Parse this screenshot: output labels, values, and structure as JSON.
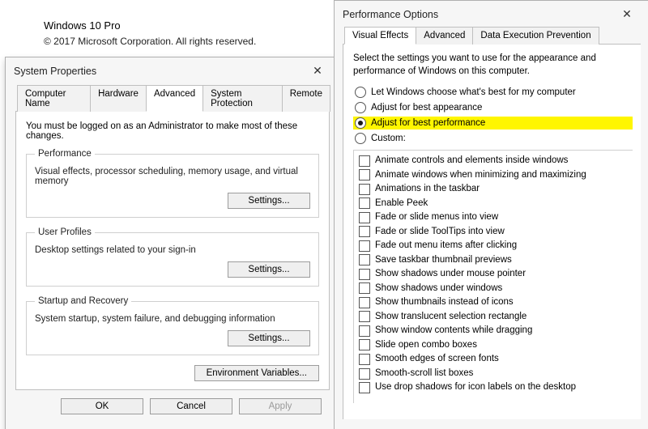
{
  "os": {
    "name": "Windows 10 Pro",
    "copyright": "© 2017 Microsoft Corporation. All rights reserved."
  },
  "sysprops": {
    "title": "System Properties",
    "close_x": "✕",
    "tabs": {
      "computer_name": "Computer Name",
      "hardware": "Hardware",
      "advanced": "Advanced",
      "system_protection": "System Protection",
      "remote": "Remote"
    },
    "notice": "You must be logged on as an Administrator to make most of these changes.",
    "groups": {
      "performance": {
        "legend": "Performance",
        "desc": "Visual effects, processor scheduling, memory usage, and virtual memory",
        "button": "Settings..."
      },
      "user_profiles": {
        "legend": "User Profiles",
        "desc": "Desktop settings related to your sign-in",
        "button": "Settings..."
      },
      "startup_recovery": {
        "legend": "Startup and Recovery",
        "desc": "System startup, system failure, and debugging information",
        "button": "Settings..."
      }
    },
    "env_button": "Environment Variables...",
    "footer": {
      "ok": "OK",
      "cancel": "Cancel",
      "apply": "Apply"
    }
  },
  "perfopts": {
    "title": "Performance Options",
    "close_x": "✕",
    "tabs": {
      "visual_effects": "Visual Effects",
      "advanced": "Advanced",
      "dep": "Data Execution Prevention"
    },
    "intro": "Select the settings you want to use for the appearance and performance of Windows on this computer.",
    "radios": {
      "let_windows": "Let Windows choose what's best for my computer",
      "best_appearance": "Adjust for best appearance",
      "best_performance": "Adjust for best performance",
      "custom": "Custom:"
    },
    "options": [
      "Animate controls and elements inside windows",
      "Animate windows when minimizing and maximizing",
      "Animations in the taskbar",
      "Enable Peek",
      "Fade or slide menus into view",
      "Fade or slide ToolTips into view",
      "Fade out menu items after clicking",
      "Save taskbar thumbnail previews",
      "Show shadows under mouse pointer",
      "Show shadows under windows",
      "Show thumbnails instead of icons",
      "Show translucent selection rectangle",
      "Show window contents while dragging",
      "Slide open combo boxes",
      "Smooth edges of screen fonts",
      "Smooth-scroll list boxes",
      "Use drop shadows for icon labels on the desktop"
    ]
  }
}
